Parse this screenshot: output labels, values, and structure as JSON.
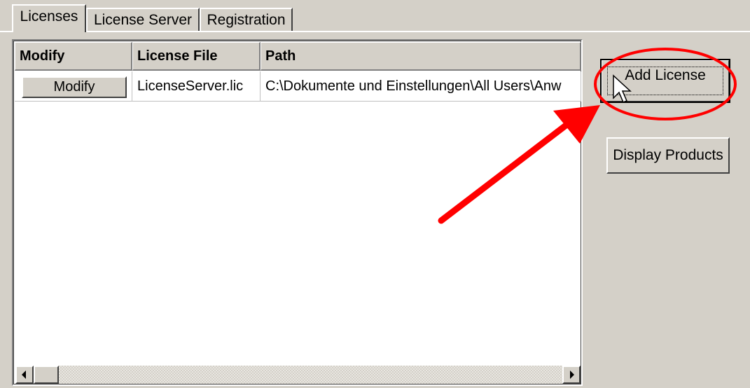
{
  "tabs": [
    {
      "label": "Licenses",
      "active": true
    },
    {
      "label": "License Server",
      "active": false
    },
    {
      "label": "Registration",
      "active": false
    }
  ],
  "grid": {
    "columns": [
      "Modify",
      "License File",
      "Path"
    ],
    "rows": [
      {
        "modify_button": "Modify",
        "license_file": "LicenseServer.lic",
        "path": "C:\\Dokumente und Einstellungen\\All Users\\Anw"
      }
    ]
  },
  "buttons": {
    "add_license": "Add License",
    "display_products": "Display Products"
  },
  "icons": [
    "scroll-left-arrow-icon",
    "scroll-right-arrow-icon",
    "mouse-pointer-icon"
  ],
  "annotation_colors": {
    "arrow": "#ff0000",
    "ellipse": "#ff0000"
  }
}
